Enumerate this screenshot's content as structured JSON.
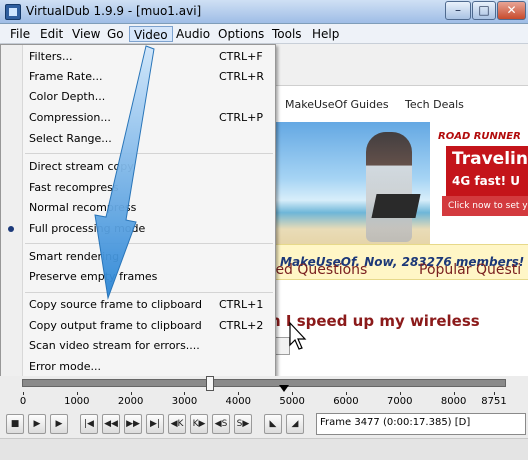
{
  "window": {
    "title": "VirtualDub 1.9.9 - [muo1.avi]",
    "minimize_glyph": "–",
    "maximize_glyph": "□",
    "close_glyph": "✕"
  },
  "menubar": [
    "File",
    "Edit",
    "View",
    "Go",
    "Video",
    "Audio",
    "Options",
    "Tools",
    "Help"
  ],
  "active_menu": "Video",
  "video_menu": {
    "items": [
      {
        "label": "Filters...",
        "shortcut": "CTRL+F"
      },
      {
        "label": "Frame Rate...",
        "shortcut": "CTRL+R"
      },
      {
        "label": "Color Depth...",
        "shortcut": ""
      },
      {
        "label": "Compression...",
        "shortcut": "CTRL+P"
      },
      {
        "label": "Select Range...",
        "shortcut": ""
      },
      {
        "label": "Direct stream copy",
        "shortcut": ""
      },
      {
        "label": "Fast recompress",
        "shortcut": ""
      },
      {
        "label": "Normal recompress",
        "shortcut": ""
      },
      {
        "label": "Full processing mode",
        "shortcut": ""
      },
      {
        "label": "Smart rendering",
        "shortcut": ""
      },
      {
        "label": "Preserve empty frames",
        "shortcut": ""
      },
      {
        "label": "Copy source frame to clipboard",
        "shortcut": "CTRL+1"
      },
      {
        "label": "Copy output frame to clipboard",
        "shortcut": "CTRL+2"
      },
      {
        "label": "Scan video stream for errors....",
        "shortcut": ""
      },
      {
        "label": "Error mode...",
        "shortcut": ""
      }
    ],
    "selected_radio": "Full processing mode"
  },
  "video_frame": {
    "nav_links": [
      "MakeUseOf Guides",
      "Tech Deals"
    ],
    "ad": {
      "brand": "ROAD RUNNER",
      "headline_1": "Traveling",
      "headline_2": "4G fast! U",
      "sub": "Click now to set y"
    },
    "members_bar": "MakeUseOf. Now, 283276 members!",
    "tabs": [
      "red Questions",
      "Popular Questi"
    ],
    "headline": "n I speed up my wireless",
    "ask_fragment": "t?"
  },
  "timeline": {
    "ticks": [
      "0",
      "1000",
      "2000",
      "3000",
      "4000",
      "5000",
      "6000",
      "7000",
      "8000",
      "8751"
    ],
    "current_frame": 3477,
    "marker_frame": 4840,
    "total_frames": 8751
  },
  "toolbar": {
    "buttons": [
      {
        "name": "stop-button-icon",
        "glyph": "■"
      },
      {
        "name": "play-input-button-icon",
        "glyph": "▶"
      },
      {
        "name": "play-output-button-icon",
        "glyph": "▶"
      },
      {
        "name": "go-start-button-icon",
        "glyph": "|◀"
      },
      {
        "name": "step-back-button-icon",
        "glyph": "◀◀"
      },
      {
        "name": "step-forward-button-icon",
        "glyph": "▶▶"
      },
      {
        "name": "go-end-button-icon",
        "glyph": "▶|"
      },
      {
        "name": "prev-keyframe-button-icon",
        "glyph": "◀K"
      },
      {
        "name": "next-keyframe-button-icon",
        "glyph": "K▶"
      },
      {
        "name": "scene-back-button-icon",
        "glyph": "◀S"
      },
      {
        "name": "scene-forward-button-icon",
        "glyph": "S▶"
      },
      {
        "name": "mark-in-button-icon",
        "glyph": "◣"
      },
      {
        "name": "mark-out-button-icon",
        "glyph": "◢"
      }
    ],
    "frame_readout": "Frame 3477 (0:00:17.385) [D]"
  },
  "colors": {
    "titlebar": "#9fbde6",
    "menu_bg": "#f5f5f5",
    "annotation_arrow": "#2b86d6",
    "ad_red": "#c4141a",
    "members_text": "#1c3878",
    "headline": "#8b1a1a"
  }
}
